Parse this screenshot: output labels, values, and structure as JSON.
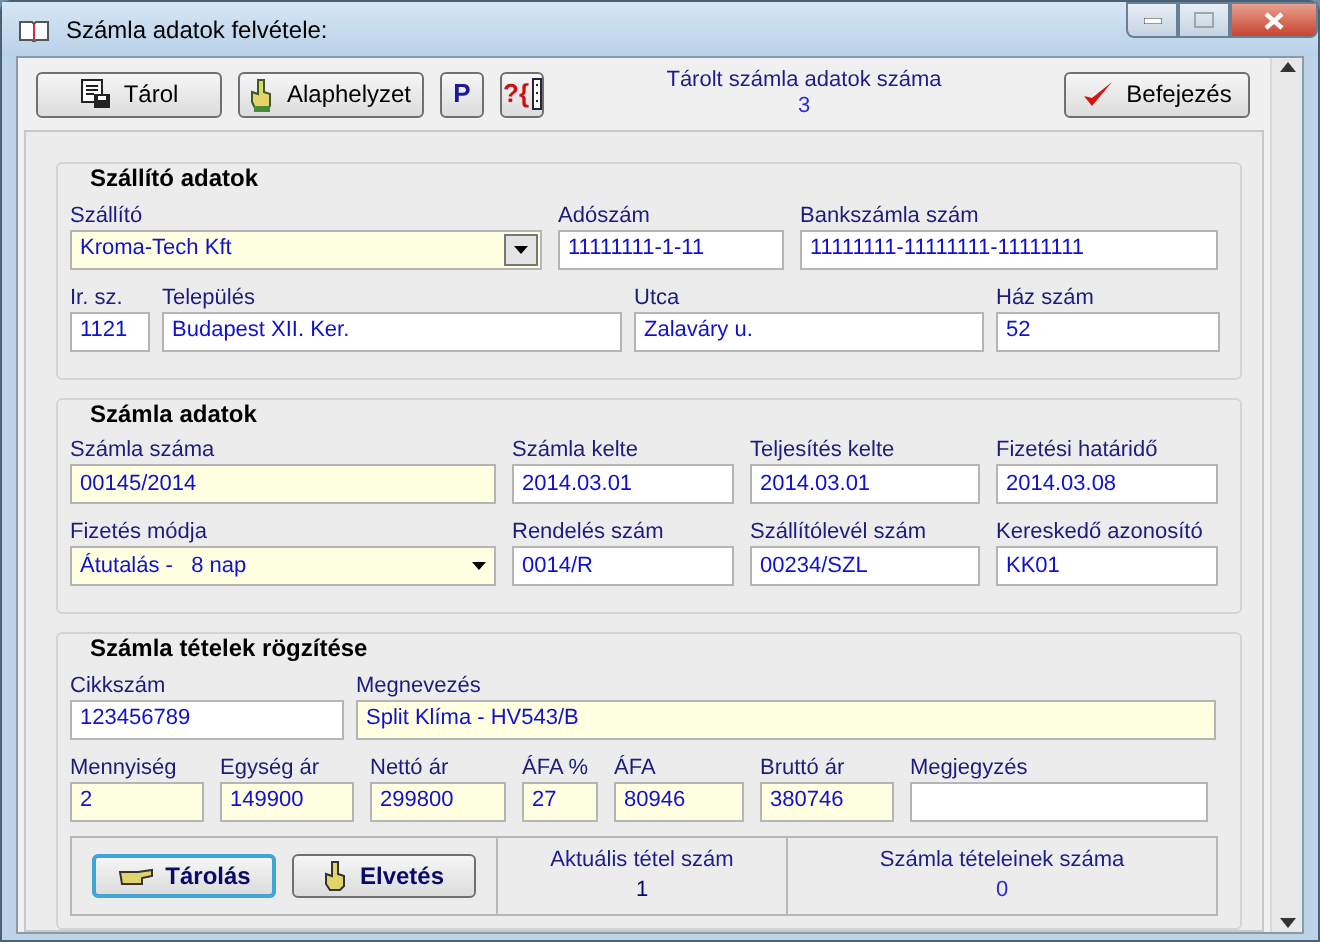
{
  "window": {
    "title": "Számla adatok felvétele:"
  },
  "toolbar": {
    "buttons": [
      {
        "label": "Tárol",
        "kind": "save"
      },
      {
        "label": "Alaphelyzet",
        "kind": "reset"
      },
      {
        "label": "P",
        "kind": "letter"
      },
      {
        "label": "?{",
        "kind": "help"
      }
    ],
    "counter": {
      "label": "Tárolt számla adatok száma",
      "value": "3"
    },
    "finish_button": {
      "label": "Befejezés"
    }
  },
  "sections": [
    {
      "title": "Szállító adatok",
      "fields": [
        {
          "label": "Szállító",
          "value": "Kroma-Tech Kft",
          "kind": "combo",
          "required": true
        },
        {
          "label": "Adószám",
          "value": "11111111-1-11",
          "kind": "text",
          "required": false
        },
        {
          "label": "Bankszámla szám",
          "value": "11111111-11111111-11111111",
          "kind": "text",
          "required": false
        },
        {
          "label": "Ir. sz.",
          "value": "1121",
          "kind": "text",
          "required": false
        },
        {
          "label": "Település",
          "value": "Budapest XII. Ker.",
          "kind": "text",
          "required": false
        },
        {
          "label": "Utca",
          "value": "Zalaváry u.",
          "kind": "text",
          "required": false
        },
        {
          "label": "Ház szám",
          "value": "52",
          "kind": "text",
          "required": false
        }
      ]
    },
    {
      "title": "Számla adatok",
      "fields": [
        {
          "label": "Számla száma",
          "value": "00145/2014",
          "kind": "text",
          "required": true
        },
        {
          "label": "Számla kelte",
          "value": "2014.03.01",
          "kind": "text",
          "required": false
        },
        {
          "label": "Teljesítés kelte",
          "value": "2014.03.01",
          "kind": "text",
          "required": false
        },
        {
          "label": "Fizetési határidő",
          "value": "2014.03.08",
          "kind": "text",
          "required": false
        },
        {
          "label": "Fizetés módja",
          "value": "Átutalás -   8 nap",
          "kind": "dropdown",
          "required": true
        },
        {
          "label": "Rendelés szám",
          "value": "0014/R",
          "kind": "text",
          "required": false
        },
        {
          "label": "Szállítólevél szám",
          "value": "00234/SZL",
          "kind": "text",
          "required": false
        },
        {
          "label": "Kereskedő azonosító",
          "value": "KK01",
          "kind": "text",
          "required": false
        }
      ]
    },
    {
      "title": "Számla tételek rögzítése",
      "fields": [
        {
          "label": "Cikkszám",
          "value": "123456789",
          "kind": "text",
          "required": false
        },
        {
          "label": "Megnevezés",
          "value": "Split Klíma - HV543/B",
          "kind": "text",
          "required": true
        },
        {
          "label": "Mennyiség",
          "value": "2",
          "kind": "text",
          "required": true
        },
        {
          "label": "Egység ár",
          "value": "149900",
          "kind": "text",
          "required": true
        },
        {
          "label": "Nettó ár",
          "value": "299800",
          "kind": "text",
          "required": true
        },
        {
          "label": "ÁFA %",
          "value": "27",
          "kind": "text",
          "required": true
        },
        {
          "label": "ÁFA",
          "value": "80946",
          "kind": "text",
          "required": true
        },
        {
          "label": "Bruttó ár",
          "value": "380746",
          "kind": "text",
          "required": true
        },
        {
          "label": "Megjegyzés",
          "kind": "text",
          "required": false
        }
      ]
    }
  ],
  "item_panel": {
    "buttons": [
      {
        "label": "Tárolás",
        "kind": "store",
        "focused": true
      },
      {
        "label": "Elvetés",
        "kind": "discard",
        "focused": false
      }
    ],
    "counters": [
      {
        "label": "Aktuális tétel szám",
        "value": "1"
      },
      {
        "label": "Számla tételeinek száma",
        "value": "0"
      }
    ]
  }
}
